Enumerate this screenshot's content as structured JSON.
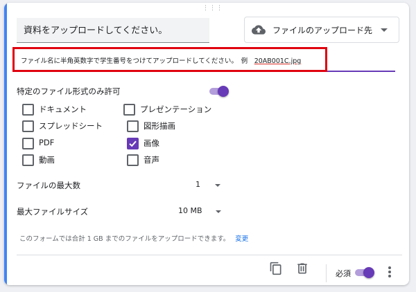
{
  "question": {
    "title": "資料をアップロードしてください。"
  },
  "question_type": {
    "label": "ファイルのアップロード先",
    "icon": "cloud-upload-icon"
  },
  "description": {
    "text": "ファイル名に半角英数字で学生番号をつけてアップロードしてください。　例　",
    "example": "20AB001C.jpg"
  },
  "file_types": {
    "toggle_label": "特定のファイル形式のみ許可",
    "toggle_on": true,
    "options": [
      {
        "label": "ドキュメント",
        "checked": false
      },
      {
        "label": "プレゼンテーション",
        "checked": false
      },
      {
        "label": "スプレッドシート",
        "checked": false
      },
      {
        "label": "図形描画",
        "checked": false
      },
      {
        "label": "PDF",
        "checked": false
      },
      {
        "label": "画像",
        "checked": true
      },
      {
        "label": "動画",
        "checked": false
      },
      {
        "label": "音声",
        "checked": false
      }
    ]
  },
  "max_files": {
    "label": "ファイルの最大数",
    "value": "1"
  },
  "max_size": {
    "label": "最大ファイルサイズ",
    "value": "10 MB"
  },
  "quota_note": {
    "text": "このフォームでは合計 1 GB までのファイルをアップロードできます。",
    "link": "変更"
  },
  "footer": {
    "required_label": "必須",
    "required_on": true
  },
  "colors": {
    "accent": "#673ab7",
    "highlight": "#e0000f",
    "card_accent": "#4285f4"
  }
}
